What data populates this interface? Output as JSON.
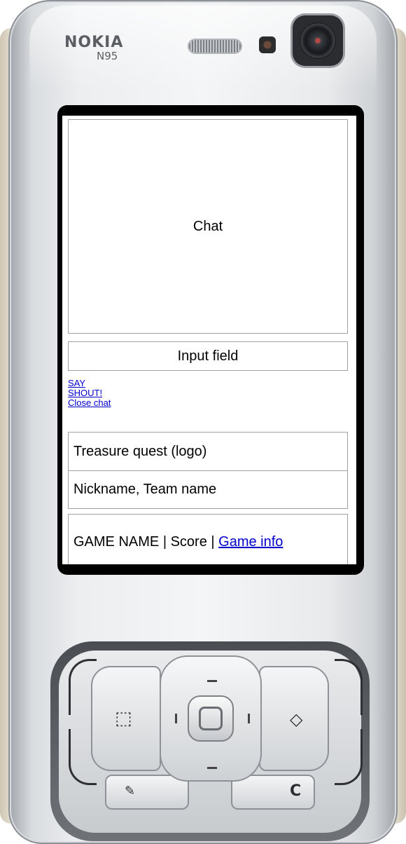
{
  "device": {
    "brand": "NOKIA",
    "model": "N95"
  },
  "screen": {
    "chat_area_label": "Chat",
    "input_field_label": "Input field",
    "actions": [
      {
        "label": "SAY"
      },
      {
        "label": "SHOUT!"
      },
      {
        "label": "Close chat"
      }
    ],
    "logo_label": "Treasure quest (logo)",
    "player_info": "Nickname, Team name",
    "status_bar": {
      "game_name": "GAME NAME",
      "separator": "|",
      "score_label": "Score",
      "game_info_link": "Game info"
    },
    "link_color": "#0000cc"
  },
  "keypad": {
    "icons": [
      "menu-icon",
      "multimedia-icon",
      "edit-icon",
      "clear-icon"
    ],
    "clear_key_label": "C"
  }
}
